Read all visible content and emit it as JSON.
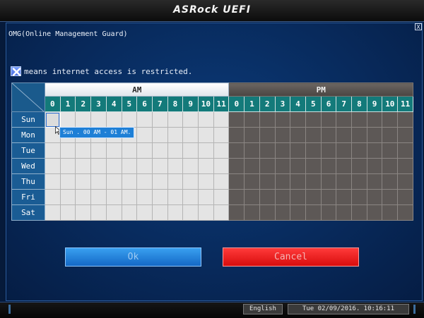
{
  "header": {
    "logo": "ASRock UEFI"
  },
  "dialog": {
    "title": "OMG(Online Management Guard)",
    "close_label": "X",
    "legend": {
      "icon": "restricted-x-icon",
      "text": "means internet access is restricted."
    },
    "periods": [
      "AM",
      "PM"
    ],
    "hours": [
      "0",
      "1",
      "2",
      "3",
      "4",
      "5",
      "6",
      "7",
      "8",
      "9",
      "10",
      "11"
    ],
    "days": [
      "Sun",
      "Mon",
      "Tue",
      "Wed",
      "Thu",
      "Fri",
      "Sat"
    ],
    "selected_cell": {
      "day": "Sun",
      "period": "AM",
      "hour": "0"
    },
    "tooltip": "Sun . 00 AM - 01 AM.",
    "ok_label": "Ok",
    "cancel_label": "Cancel"
  },
  "footer": {
    "language": "English",
    "datetime": "Tue 02/09/2016. 10:16:11"
  },
  "colors": {
    "am_bg": "#e4e4e4",
    "pm_bg": "#5d5856",
    "hour_header": "#137a7a",
    "ok": "#1e7fd6",
    "cancel": "#ff2020"
  }
}
